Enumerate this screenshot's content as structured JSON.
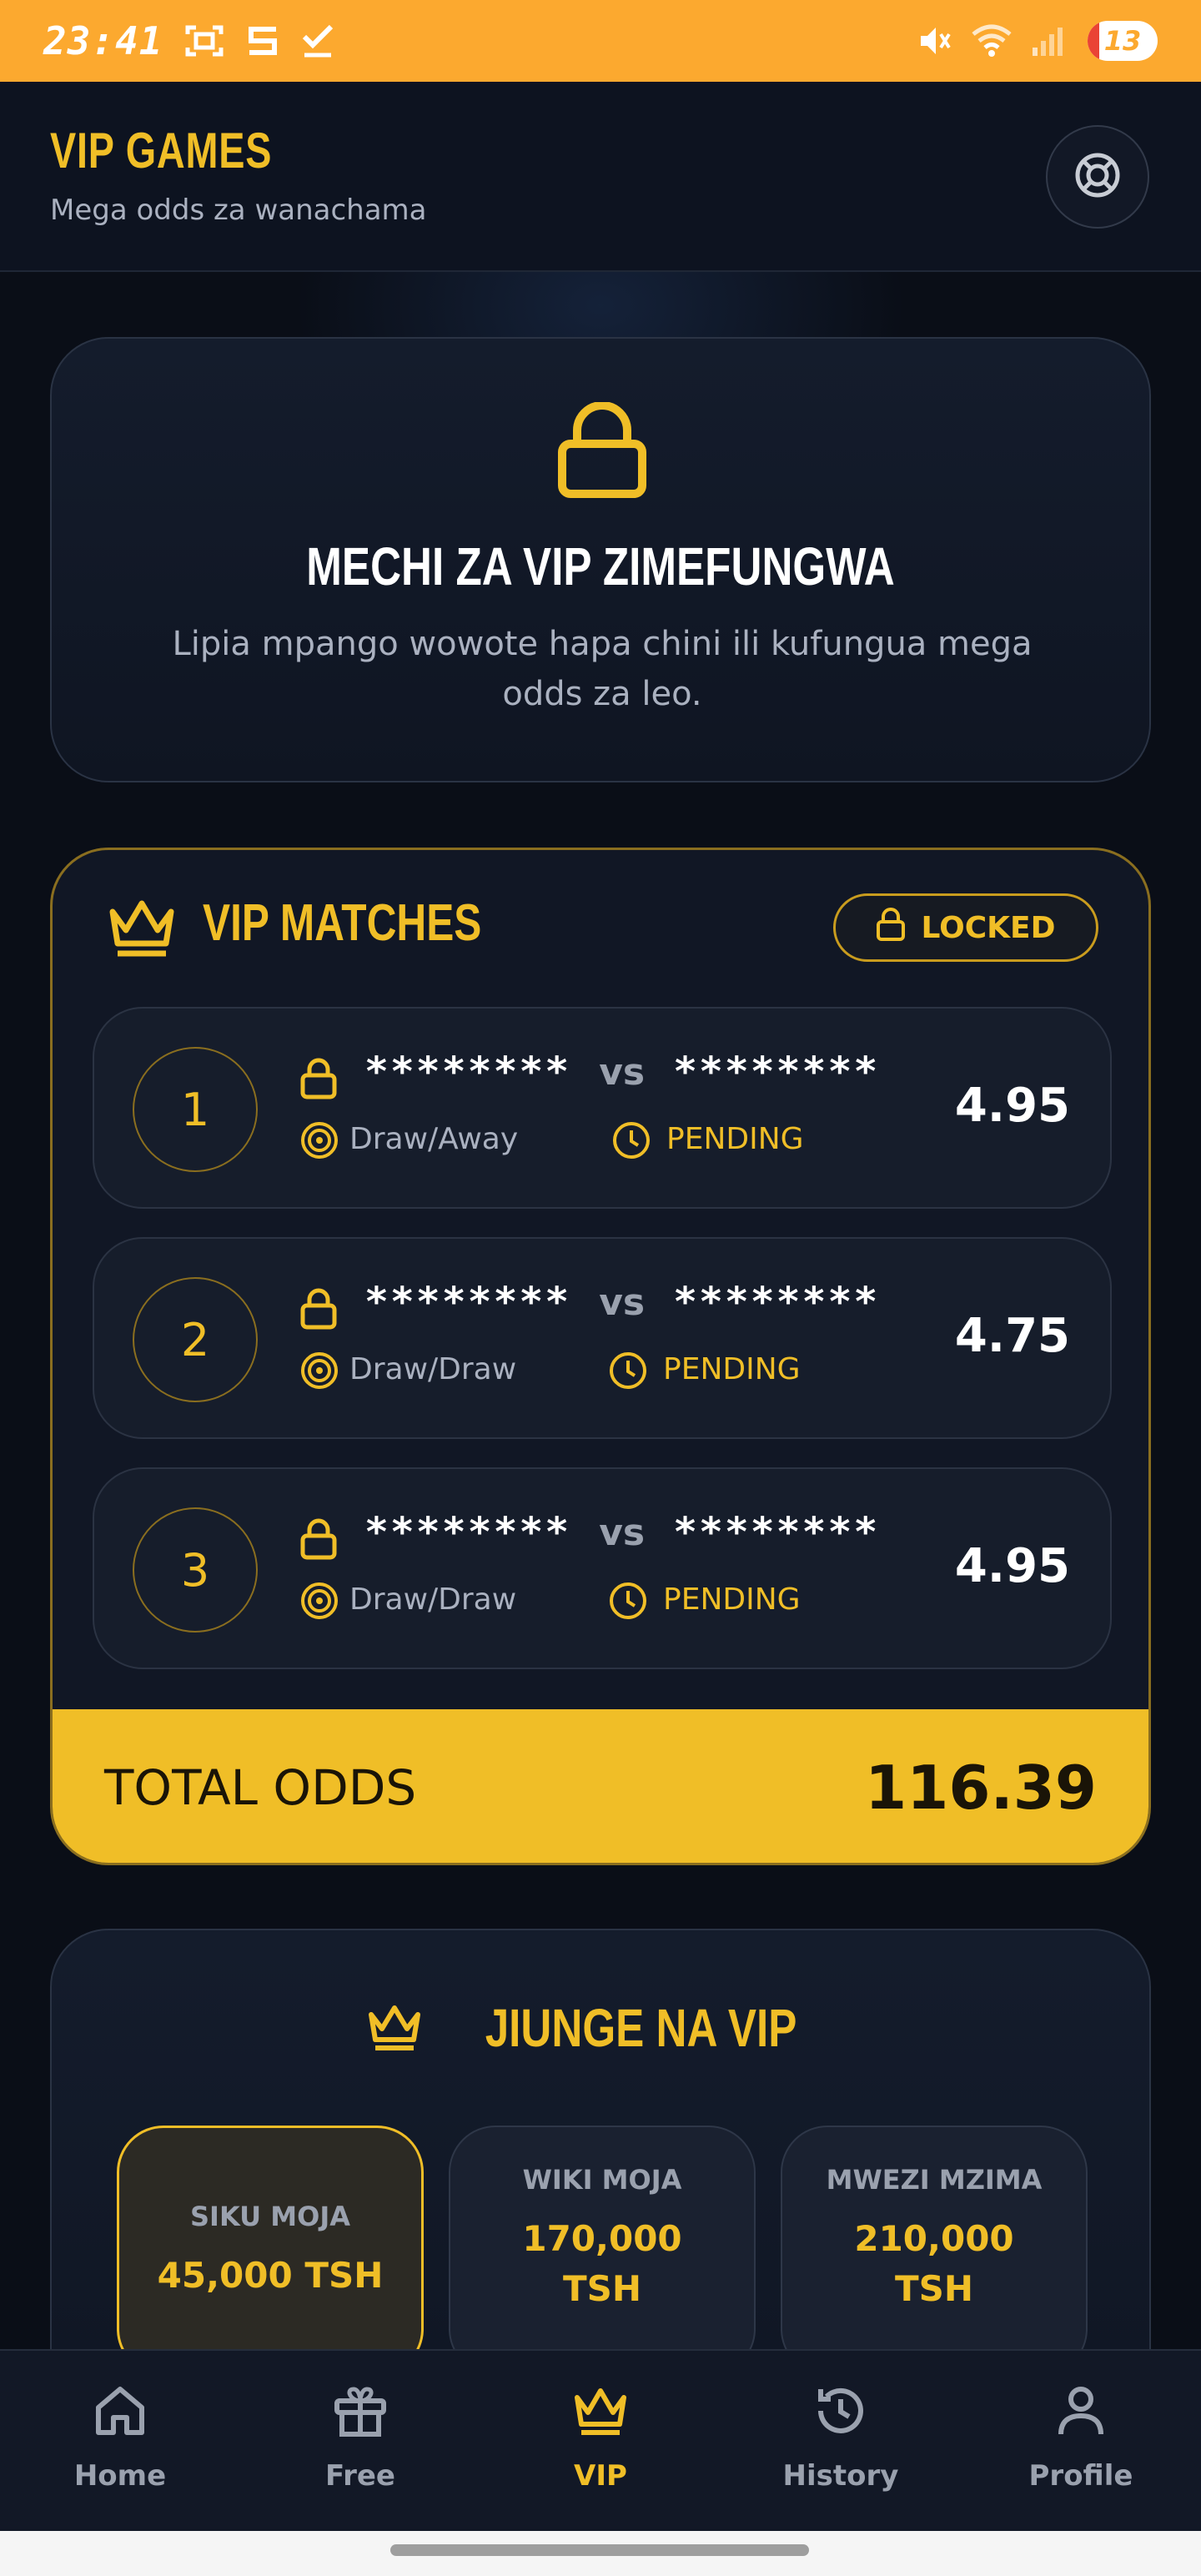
{
  "status_bar": {
    "time": "23:41",
    "battery": "13"
  },
  "header": {
    "title": "VIP GAMES",
    "subtitle": "Mega odds za wanachama"
  },
  "locked_notice": {
    "title": "MECHI ZA VIP ZIMEFUNGWA",
    "description": "Lipia mpango wowote hapa chini ili kufungua mega odds za leo."
  },
  "vip_matches": {
    "title": "VIP MATCHES",
    "badge": "LOCKED",
    "matches": [
      {
        "number": "1",
        "home": "********",
        "vs": "vs",
        "away": "********",
        "pick": "Draw/Away",
        "status": "PENDING",
        "odd": "4.95"
      },
      {
        "number": "2",
        "home": "********",
        "vs": "vs",
        "away": "********",
        "pick": "Draw/Draw",
        "status": "PENDING",
        "odd": "4.75"
      },
      {
        "number": "3",
        "home": "********",
        "vs": "vs",
        "away": "********",
        "pick": "Draw/Draw",
        "status": "PENDING",
        "odd": "4.95"
      }
    ],
    "total_label": "TOTAL ODDS",
    "total_value": "116.39"
  },
  "join_vip": {
    "title": "JIUNGE NA VIP",
    "plans": [
      {
        "name": "SIKU MOJA",
        "price": "45,000 TSH",
        "selected": true
      },
      {
        "name": "WIKI MOJA",
        "price": "170,000 TSH",
        "selected": false
      },
      {
        "name": "MWEZI MZIMA",
        "price": "210,000 TSH",
        "selected": false
      }
    ]
  },
  "bottom_nav": {
    "items": [
      {
        "label": "Home",
        "icon": "home-icon"
      },
      {
        "label": "Free",
        "icon": "gift-icon"
      },
      {
        "label": "VIP",
        "icon": "crown-icon",
        "active": true
      },
      {
        "label": "History",
        "icon": "history-icon"
      },
      {
        "label": "Profile",
        "icon": "person-icon"
      }
    ]
  },
  "colors": {
    "accent": "#f0be27",
    "status_bar": "#fca92f",
    "background": "#0a0e17"
  }
}
